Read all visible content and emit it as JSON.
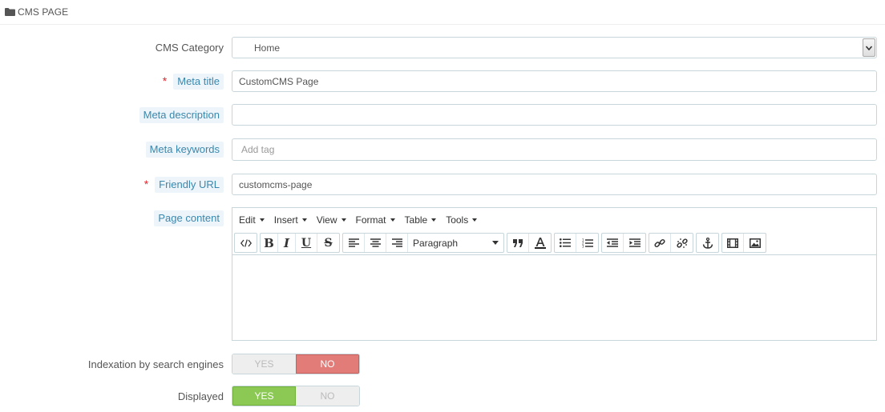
{
  "panel": {
    "title": "CMS PAGE",
    "icon": "folder-icon"
  },
  "form": {
    "cms_category": {
      "label": "CMS Category",
      "value": "Home"
    },
    "meta_title": {
      "label": "Meta title",
      "required_mark": "*",
      "value": "CustomCMS Page"
    },
    "meta_description": {
      "label": "Meta description",
      "value": ""
    },
    "meta_keywords": {
      "label": "Meta keywords",
      "placeholder": "Add tag"
    },
    "friendly_url": {
      "label": "Friendly URL",
      "required_mark": "*",
      "value": "customcms-page"
    },
    "page_content": {
      "label": "Page content"
    },
    "indexation": {
      "label": "Indexation by search engines",
      "yes": "YES",
      "no": "NO",
      "selected": "NO"
    },
    "displayed": {
      "label": "Displayed",
      "yes": "YES",
      "no": "NO",
      "selected": "YES"
    }
  },
  "editor": {
    "menus": [
      "Edit",
      "Insert",
      "View",
      "Format",
      "Table",
      "Tools"
    ],
    "format_select": "Paragraph",
    "toolbar_icons": [
      "source-code-icon",
      "bold-icon",
      "italic-icon",
      "underline-icon",
      "strikethrough-icon",
      "align-left-icon",
      "align-center-icon",
      "align-right-icon",
      "blockquote-icon",
      "text-color-icon",
      "bullet-list-icon",
      "numbered-list-icon",
      "outdent-icon",
      "indent-icon",
      "link-icon",
      "unlink-icon",
      "anchor-icon",
      "media-icon",
      "image-icon"
    ]
  },
  "colors": {
    "help_label": "#3a87ad",
    "switch_no": "#e27c79",
    "switch_yes": "#8bc954",
    "required": "#e0262f"
  }
}
